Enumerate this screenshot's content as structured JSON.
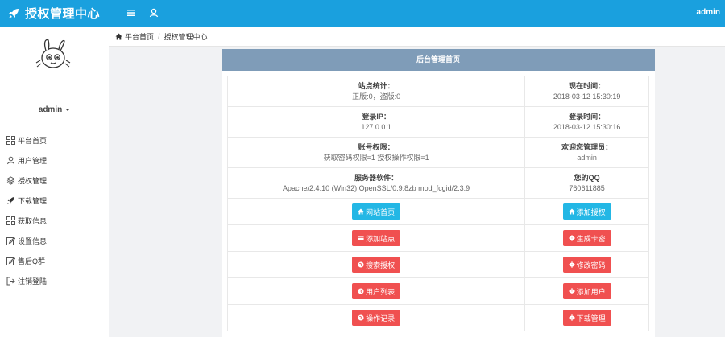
{
  "header": {
    "title": "授权管理中心",
    "user": "admin"
  },
  "sidebar": {
    "username": "admin",
    "items": [
      {
        "label": "平台首页",
        "icon": "grid-icon"
      },
      {
        "label": "用户管理",
        "icon": "user-icon"
      },
      {
        "label": "授权管理",
        "icon": "layers-icon"
      },
      {
        "label": "下载管理",
        "icon": "rocket-icon"
      },
      {
        "label": "获取信息",
        "icon": "grid-icon"
      },
      {
        "label": "设置信息",
        "icon": "edit-icon"
      },
      {
        "label": "售后Q群",
        "icon": "edit-icon"
      },
      {
        "label": "注销登陆",
        "icon": "logout-icon"
      }
    ]
  },
  "breadcrumb": {
    "home": "平台首页",
    "current": "授权管理中心"
  },
  "panel": {
    "title": "后台管理首页",
    "info": [
      {
        "left_label": "站点统计：",
        "left_value": "正版:0，盗版:0",
        "right_label": "现在时间：",
        "right_value": "2018-03-12 15:30:19"
      },
      {
        "left_label": "登录IP：",
        "left_value": "127.0.0.1",
        "right_label": "登录时间：",
        "right_value": "2018-03-12 15:30:16"
      },
      {
        "left_label": "账号权限：",
        "left_value": "获取密码权限=1 授权操作权限=1",
        "right_label": "欢迎您管理员：",
        "right_value": "admin"
      },
      {
        "left_label": "服务器软件：",
        "left_value": "Apache/2.4.10 (Win32) OpenSSL/0.9.8zb mod_fcgid/2.3.9",
        "right_label": "您的QQ",
        "right_value": "760611885"
      }
    ],
    "buttons": [
      {
        "left": "网站首页",
        "right": "添加授权"
      },
      {
        "left": "添加站点",
        "right": "生成卡密"
      },
      {
        "left": "搜索授权",
        "right": "修改密码"
      },
      {
        "left": "用户列表",
        "right": "添加用户"
      },
      {
        "left": "操作记录",
        "right": "下载管理"
      }
    ]
  },
  "colors": {
    "topbar": "#1aa0de",
    "panel_head": "#7f9cb8",
    "btn_blue": "#23b7e5",
    "btn_red": "#f05050"
  }
}
